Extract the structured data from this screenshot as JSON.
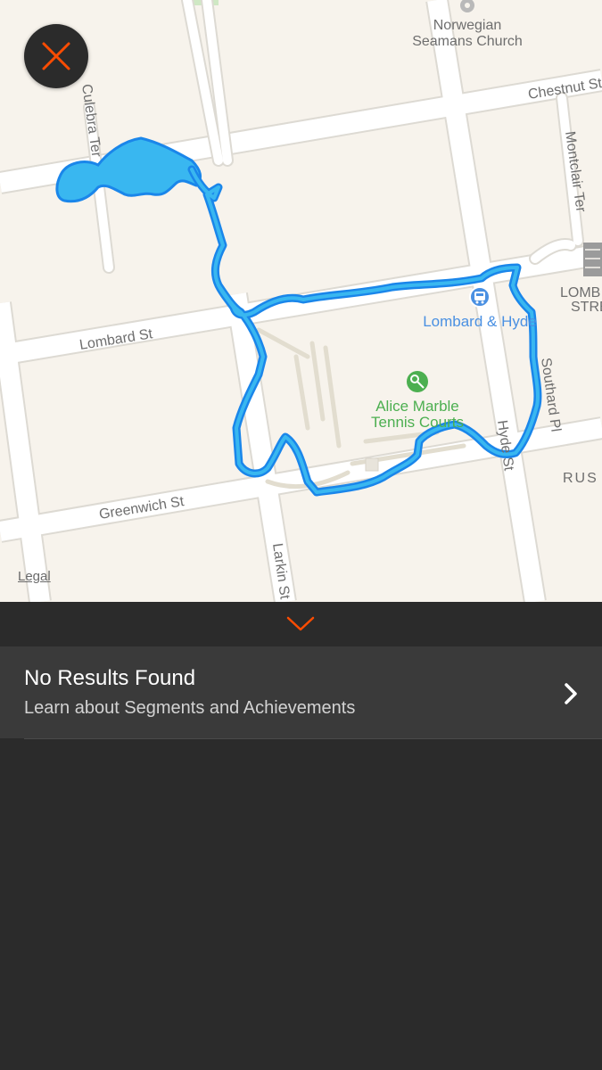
{
  "map": {
    "labels": {
      "norwegian_church_line1": "Norwegian",
      "norwegian_church_line2": "Seamans Church",
      "chestnut_st": "Chestnut St",
      "culebra_ter": "Culebra Ter",
      "montclair_ter": "Montclair Ter",
      "lombard_st": "Lombard St",
      "lombard_hyde": "Lombard & Hyde",
      "alice_marble_line1": "Alice Marble",
      "alice_marble_line2": "Tennis Courts",
      "southard_pl": "Southard Pl",
      "hyde_st": "Hyde St",
      "greenwich_st": "Greenwich St",
      "larkin_st": "Larkin St",
      "lombard_street_line1": "LOMB",
      "lombard_street_line2": "STRE",
      "russian_hill": "RUS"
    },
    "legal": "Legal",
    "colors": {
      "route": "#1a86ea",
      "route_fill": "#39b7f0",
      "park_text": "#4caf50",
      "transit_text": "#4a90e2",
      "accent": "#fc4c02"
    },
    "icons": {
      "close": "close-icon",
      "tennis": "tennis-icon",
      "bus": "bus-stop-icon",
      "church": "church-pin-icon"
    }
  },
  "sheet": {
    "collapse_icon": "chevron-down-icon",
    "results": {
      "title": "No Results Found",
      "subtitle": "Learn about Segments and Achievements",
      "chevron_icon": "chevron-right-icon"
    }
  }
}
